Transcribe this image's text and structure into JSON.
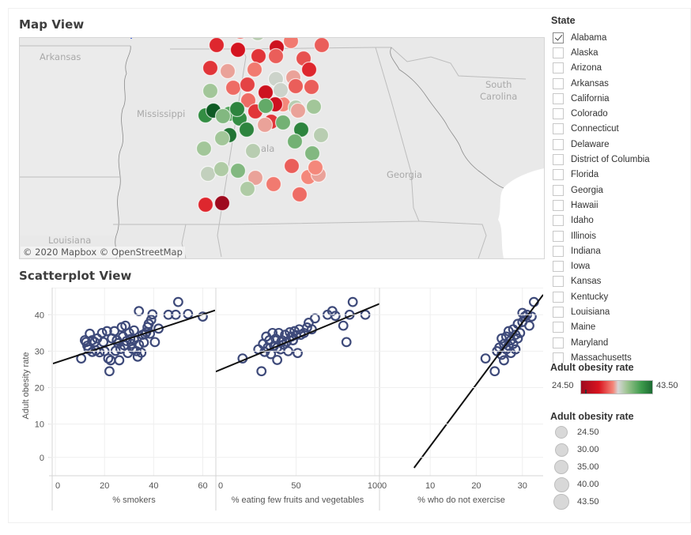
{
  "map_view": {
    "title": "Map View",
    "labels": {
      "arkansas": "Arkansas",
      "mississippi": "Mississippi",
      "louisiana": "Louisiana",
      "georgia": "Georgia",
      "south_carolina_1": "South",
      "south_carolina_2": "Carolina",
      "alabama_partial": "ala"
    },
    "attribution": "© 2020 Mapbox © OpenStreetMap",
    "color_scale": {
      "min": 24.5,
      "max": 43.5,
      "low_color": "#9e0a1e",
      "mid_color": "#d6d6d6",
      "high_color": "#1d6b33"
    },
    "counties": [
      {
        "row": 0,
        "col": 0,
        "rate": 31.5
      },
      {
        "row": 0,
        "col": 1,
        "rate": 35.5
      },
      {
        "row": 0,
        "col": 2,
        "rate": 27.5
      },
      {
        "row": 0,
        "col": 3,
        "rate": 30.5
      },
      {
        "row": 0,
        "col": 4,
        "rate": 30.5
      },
      {
        "row": 1,
        "col": 0,
        "rate": 30.0
      },
      {
        "row": 1,
        "col": 1,
        "rate": 31.5
      },
      {
        "row": 1,
        "col": 2,
        "rate": 35.5
      },
      {
        "row": 1,
        "col": 3,
        "rate": 27.5
      },
      {
        "row": 1,
        "col": 4,
        "rate": 31.0
      },
      {
        "row": 2,
        "col": 0,
        "rate": 29.0
      },
      {
        "row": 2,
        "col": 1,
        "rate": 28.0
      },
      {
        "row": 2,
        "col": 2,
        "rate": 29.5
      },
      {
        "row": 2,
        "col": 3,
        "rate": 31.0
      },
      {
        "row": 2,
        "col": 4,
        "rate": 32.0
      },
      {
        "row": 2,
        "col": 5,
        "rate": 30.5
      },
      {
        "row": 3,
        "col": 0,
        "rate": 29.5
      },
      {
        "row": 3,
        "col": 1,
        "rate": 33.0
      },
      {
        "row": 3,
        "col": 2,
        "rate": 32.0
      },
      {
        "row": 3,
        "col": 3,
        "rate": 34.5
      },
      {
        "row": 3,
        "col": 4,
        "rate": 33.0
      },
      {
        "row": 3,
        "col": 5,
        "rate": 29.0
      },
      {
        "row": 4,
        "col": 0,
        "rate": 36.5
      },
      {
        "row": 4,
        "col": 1,
        "rate": 31.5
      },
      {
        "row": 4,
        "col": 2,
        "rate": 30.0
      },
      {
        "row": 4,
        "col": 3,
        "rate": 27.5
      },
      {
        "row": 4,
        "col": 4,
        "rate": 32.5
      },
      {
        "row": 4,
        "col": 5,
        "rate": 31.0
      },
      {
        "row": 4,
        "col": 6,
        "rate": 31.0
      },
      {
        "row": 5,
        "col": 0,
        "rate": 31.5
      },
      {
        "row": 5,
        "col": 1,
        "rate": 34.5
      },
      {
        "row": 5,
        "col": 2,
        "rate": 35.5
      },
      {
        "row": 5,
        "col": 3,
        "rate": 33.0
      },
      {
        "row": 5,
        "col": 4,
        "rate": 36.5
      },
      {
        "row": 6,
        "col": 0,
        "rate": 40.5
      },
      {
        "row": 6,
        "col": 1,
        "rate": 43.5
      },
      {
        "row": 6,
        "col": 2,
        "rate": 39.0
      },
      {
        "row": 6,
        "col": 3,
        "rate": 40.5
      },
      {
        "row": 6,
        "col": 4,
        "rate": 29.5
      },
      {
        "row": 6,
        "col": 5,
        "rate": 27.5
      },
      {
        "row": 6,
        "col": 6,
        "rate": 29.5
      },
      {
        "row": 7,
        "col": 0,
        "rate": 42.0
      },
      {
        "row": 7,
        "col": 1,
        "rate": 41.0
      },
      {
        "row": 7,
        "col": 2,
        "rate": 33.0
      },
      {
        "row": 7,
        "col": 3,
        "rate": 41.0
      },
      {
        "row": 7,
        "col": 4,
        "rate": 35.5
      },
      {
        "row": 8,
        "col": 0,
        "rate": 37.5
      },
      {
        "row": 8,
        "col": 1,
        "rate": 41.0
      },
      {
        "row": 8,
        "col": 2,
        "rate": 38.5
      },
      {
        "row": 8,
        "col": 3,
        "rate": 38.0
      },
      {
        "row": 9,
        "col": 0,
        "rate": 36.5
      },
      {
        "row": 9,
        "col": 1,
        "rate": 36.5
      },
      {
        "row": 9,
        "col": 2,
        "rate": 35.5
      },
      {
        "row": 9,
        "col": 3,
        "rate": 38.0
      },
      {
        "row": 9,
        "col": 4,
        "rate": 37.5
      },
      {
        "row": 10,
        "col": 0,
        "rate": 35.0
      },
      {
        "row": 10,
        "col": 1,
        "rate": 36.0
      },
      {
        "row": 10,
        "col": 2,
        "rate": 37.5
      },
      {
        "row": 10,
        "col": 3,
        "rate": 33.0
      },
      {
        "row": 10,
        "col": 4,
        "rate": 32.0
      },
      {
        "row": 10,
        "col": 5,
        "rate": 32.5
      },
      {
        "row": 10,
        "col": 6,
        "rate": 33.0
      },
      {
        "row": 11,
        "col": 0,
        "rate": 36.0
      },
      {
        "row": 11,
        "col": 1,
        "rate": 31.0
      },
      {
        "row": 11,
        "col": 2,
        "rate": 31.5
      },
      {
        "row": 11,
        "col": 3,
        "rate": 32.5
      },
      {
        "row": 12,
        "col": 0,
        "rate": 29.0
      },
      {
        "row": 12,
        "col": 1,
        "rate": 24.5
      }
    ]
  },
  "scatter_view": {
    "title": "Scatterplot View"
  },
  "chart_data": {
    "type": "scatter",
    "ylabel": "Adult obesity rate",
    "ylim": [
      -2,
      47
    ],
    "yticks": [
      "0",
      "10",
      "20",
      "30",
      "40"
    ],
    "yticks_values": [
      0,
      10,
      20,
      30,
      40
    ],
    "grid": true,
    "panels": [
      {
        "xlabel": "% smokers",
        "xlim": [
          -1,
          65
        ],
        "xticks": [
          "0",
          "20",
          "40",
          "60"
        ],
        "xticks_values": [
          0,
          20,
          40,
          60
        ],
        "trend": {
          "x0": -1,
          "y0": 26.6,
          "x1": 65,
          "y1": 41.2
        },
        "points": [
          [
            10.5,
            28
          ],
          [
            12,
            33
          ],
          [
            12.5,
            32.5
          ],
          [
            13,
            31.5
          ],
          [
            13.5,
            30.5
          ],
          [
            14,
            34.8
          ],
          [
            15,
            33
          ],
          [
            15,
            29.8
          ],
          [
            16,
            32.5
          ],
          [
            16.5,
            30.2
          ],
          [
            17,
            33.5
          ],
          [
            18,
            29.7
          ],
          [
            19,
            35
          ],
          [
            19.5,
            32.5
          ],
          [
            20,
            30
          ],
          [
            21,
            35.5
          ],
          [
            21.5,
            28
          ],
          [
            22,
            24.5
          ],
          [
            22.5,
            27.5
          ],
          [
            23,
            33.5
          ],
          [
            24,
            35.5
          ],
          [
            24.5,
            30.1
          ],
          [
            25,
            33
          ],
          [
            25.5,
            32.2
          ],
          [
            26,
            27.5
          ],
          [
            26.5,
            30.6
          ],
          [
            27,
            36.6
          ],
          [
            27.5,
            34
          ],
          [
            28,
            31.6
          ],
          [
            28.5,
            37
          ],
          [
            29,
            32.8
          ],
          [
            29.5,
            29.5
          ],
          [
            30,
            35
          ],
          [
            30.5,
            33.3
          ],
          [
            31,
            32
          ],
          [
            31.5,
            30.6
          ],
          [
            32,
            35.7
          ],
          [
            32,
            33.2
          ],
          [
            33,
            30
          ],
          [
            33.5,
            28.5
          ],
          [
            34,
            41
          ],
          [
            34,
            31.8
          ],
          [
            35,
            29.6
          ],
          [
            35.5,
            34.5
          ],
          [
            36,
            32.4
          ],
          [
            36.5,
            34.7
          ],
          [
            37,
            35.2
          ],
          [
            37.5,
            36.6
          ],
          [
            38,
            37.5
          ],
          [
            38.5,
            34.8
          ],
          [
            39,
            38.6
          ],
          [
            39.5,
            40.1
          ],
          [
            40.5,
            32.5
          ],
          [
            42,
            36.2
          ],
          [
            46,
            40
          ],
          [
            49,
            40
          ],
          [
            50,
            43.5
          ],
          [
            54,
            40.2
          ],
          [
            60,
            39.5
          ]
        ]
      },
      {
        "xlabel": "% eating few fruits and vegetables",
        "xlim": [
          -1,
          103
        ],
        "xticks": [
          "0",
          "50",
          "100"
        ],
        "xticks_values": [
          0,
          50,
          100
        ],
        "trend": {
          "x0": -1,
          "y0": 24.4,
          "x1": 103,
          "y1": 43
        },
        "points": [
          [
            16,
            28
          ],
          [
            26,
            30.5
          ],
          [
            28,
            24.5
          ],
          [
            29,
            32
          ],
          [
            30,
            29.8
          ],
          [
            31,
            34
          ],
          [
            32,
            31
          ],
          [
            33,
            33
          ],
          [
            34,
            29.2
          ],
          [
            35,
            35
          ],
          [
            36,
            31.5
          ],
          [
            37,
            33.4
          ],
          [
            38,
            27.6
          ],
          [
            38,
            31
          ],
          [
            39,
            35
          ],
          [
            40,
            30.5
          ],
          [
            40.5,
            32.5
          ],
          [
            41,
            33
          ],
          [
            42,
            31.8
          ],
          [
            43,
            34.5
          ],
          [
            44,
            32.6
          ],
          [
            45,
            30
          ],
          [
            46,
            35.2
          ],
          [
            47,
            34
          ],
          [
            48,
            33
          ],
          [
            49,
            35.5
          ],
          [
            50,
            34.4
          ],
          [
            51,
            29.5
          ],
          [
            52,
            36
          ],
          [
            53,
            34.5
          ],
          [
            55,
            35
          ],
          [
            57,
            36.5
          ],
          [
            58,
            37.8
          ],
          [
            60,
            36
          ],
          [
            62,
            39
          ],
          [
            70,
            40
          ],
          [
            73,
            41
          ],
          [
            75,
            39.7
          ],
          [
            80,
            37
          ],
          [
            82,
            32.5
          ],
          [
            84,
            40
          ],
          [
            86,
            43.5
          ],
          [
            94,
            40
          ]
        ]
      },
      {
        "xlabel": "% who do not exercise",
        "xlim": [
          -1,
          34.5
        ],
        "xticks": [
          "0",
          "10",
          "20",
          "30"
        ],
        "xticks_values": [
          0,
          10,
          20,
          30
        ],
        "trend": {
          "x0": 6.5,
          "y0": -2,
          "x1": 34.5,
          "y1": 45.5
        },
        "points": [
          [
            22,
            28
          ],
          [
            24,
            24.5
          ],
          [
            24.5,
            30
          ],
          [
            25,
            31
          ],
          [
            25.5,
            33.5
          ],
          [
            25.5,
            29
          ],
          [
            26,
            32
          ],
          [
            26,
            27.5
          ],
          [
            26.5,
            34
          ],
          [
            26.5,
            30.5
          ],
          [
            27,
            35.5
          ],
          [
            27,
            31.5
          ],
          [
            27.5,
            33
          ],
          [
            27.5,
            29.5
          ],
          [
            28,
            36
          ],
          [
            28,
            32
          ],
          [
            28.5,
            34.5
          ],
          [
            28.5,
            30.5
          ],
          [
            29,
            37.5
          ],
          [
            29,
            33.5
          ],
          [
            29.5,
            35
          ],
          [
            30,
            40.5
          ],
          [
            30,
            38
          ],
          [
            30.5,
            39.5
          ],
          [
            31,
            40
          ],
          [
            31.5,
            37
          ],
          [
            32,
            39.5
          ],
          [
            32.5,
            43.5
          ]
        ]
      }
    ]
  },
  "state_filter": {
    "title": "State",
    "items": [
      {
        "label": "Alabama",
        "checked": true
      },
      {
        "label": "Alaska",
        "checked": false
      },
      {
        "label": "Arizona",
        "checked": false
      },
      {
        "label": "Arkansas",
        "checked": false
      },
      {
        "label": "California",
        "checked": false
      },
      {
        "label": "Colorado",
        "checked": false
      },
      {
        "label": "Connecticut",
        "checked": false
      },
      {
        "label": "Delaware",
        "checked": false
      },
      {
        "label": "District of Columbia",
        "checked": false
      },
      {
        "label": "Florida",
        "checked": false
      },
      {
        "label": "Georgia",
        "checked": false
      },
      {
        "label": "Hawaii",
        "checked": false
      },
      {
        "label": "Idaho",
        "checked": false
      },
      {
        "label": "Illinois",
        "checked": false
      },
      {
        "label": "Indiana",
        "checked": false
      },
      {
        "label": "Iowa",
        "checked": false
      },
      {
        "label": "Kansas",
        "checked": false
      },
      {
        "label": "Kentucky",
        "checked": false
      },
      {
        "label": "Louisiana",
        "checked": false
      },
      {
        "label": "Maine",
        "checked": false
      },
      {
        "label": "Maryland",
        "checked": false
      },
      {
        "label": "Massachusetts",
        "checked": false
      }
    ]
  },
  "color_legend": {
    "title": "Adult obesity rate",
    "min_label": "24.50",
    "max_label": "43.50"
  },
  "size_legend": {
    "title": "Adult obesity rate",
    "items": [
      "24.50",
      "30.00",
      "35.00",
      "40.00",
      "43.50"
    ]
  }
}
